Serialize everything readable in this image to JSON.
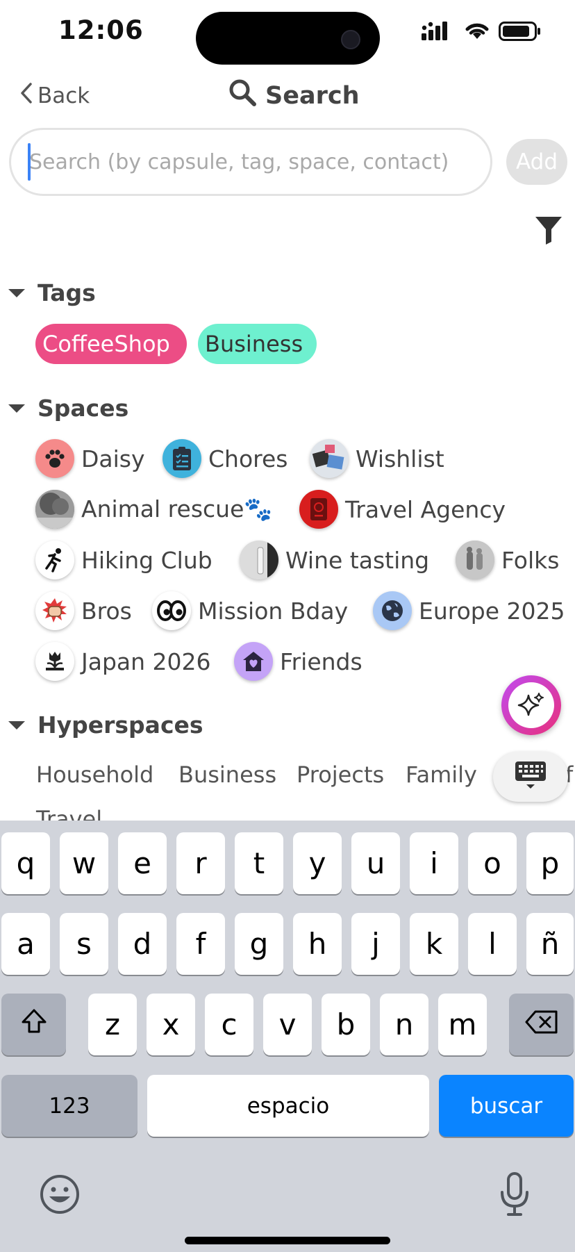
{
  "status_bar": {
    "time": "12:06"
  },
  "nav": {
    "back_label": "Back",
    "title": "Search"
  },
  "search": {
    "placeholder": "Search (by capsule, tag, space, contact)",
    "add_label": "Add"
  },
  "sections": {
    "tags": "Tags",
    "spaces": "Spaces",
    "hyperspaces": "Hyperspaces"
  },
  "tags": [
    {
      "label": "CoffeeShop",
      "bg": "#ec4d85",
      "fg": "#ffffff"
    },
    {
      "label": "Business",
      "bg": "#6ef0cf",
      "fg": "#333333"
    }
  ],
  "spaces": [
    {
      "label": "Daisy",
      "icon": "paw-icon"
    },
    {
      "label": "Chores",
      "icon": "clipboard-list-icon"
    },
    {
      "label": "Wishlist",
      "icon": "gift-photo-icon"
    },
    {
      "label": "Animal rescue🐾",
      "icon": "tree-photo-icon"
    },
    {
      "label": "Travel Agency",
      "icon": "passport-icon"
    },
    {
      "label": "Hiking Club",
      "icon": "hiker-icon"
    },
    {
      "label": "Wine tasting",
      "icon": "wine-photo-icon"
    },
    {
      "label": "Folks",
      "icon": "family-photo-icon"
    },
    {
      "label": "Bros",
      "icon": "fist-bump-icon"
    },
    {
      "label": "Mission Bday",
      "icon": "eyes-icon"
    },
    {
      "label": "Europe 2025",
      "icon": "globe-icon"
    },
    {
      "label": "Japan 2026",
      "icon": "flower-icon"
    },
    {
      "label": "Friends",
      "icon": "home-heart-icon"
    }
  ],
  "hyperspaces": [
    "Household",
    "Business",
    "Projects",
    "Family",
    "f",
    "Travel"
  ],
  "keyboard": {
    "row1": [
      "q",
      "w",
      "e",
      "r",
      "t",
      "y",
      "u",
      "i",
      "o",
      "p"
    ],
    "row2": [
      "a",
      "s",
      "d",
      "f",
      "g",
      "h",
      "j",
      "k",
      "l",
      "ñ"
    ],
    "row3": [
      "z",
      "x",
      "c",
      "v",
      "b",
      "n",
      "m"
    ],
    "numbers_label": "123",
    "space_label": "espacio",
    "action_label": "buscar"
  },
  "colors": {
    "accent_blue": "#0a84ff",
    "cursor": "#3b82f6"
  }
}
